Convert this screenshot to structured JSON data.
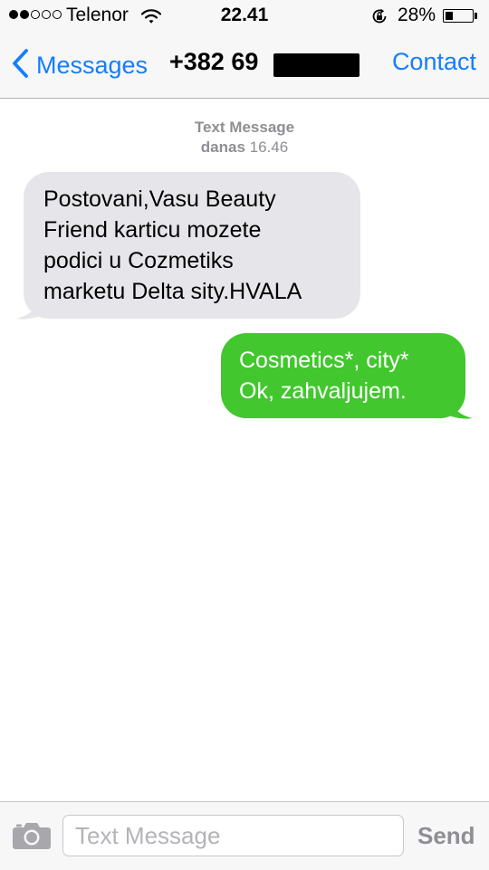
{
  "status_bar": {
    "signal_bars_filled": 2,
    "signal_bars_total": 5,
    "carrier": "Telenor",
    "wifi_icon": "wifi-icon",
    "time": "22.41",
    "orientation_lock_icon": "rotation-lock-icon",
    "battery_percent": "28%",
    "battery_level": 0.28
  },
  "nav": {
    "back_icon": "chevron-left-icon",
    "back_label": "Messages",
    "title": "+382 69",
    "contact_label": "Contact"
  },
  "conversation": {
    "service_label": "Text Message",
    "day_label": "danas",
    "time_label": "16.46",
    "messages": [
      {
        "direction": "incoming",
        "text": "Postovani,Vasu  Beauty\nFriend karticu mozete\npodici u Cozmetiks\nmarketu Delta sity.HVALA"
      },
      {
        "direction": "outgoing",
        "text": "Cosmetics*, city*\nOk, zahvaljujem."
      }
    ]
  },
  "input_bar": {
    "camera_icon": "camera-icon",
    "placeholder": "Text Message",
    "value": "",
    "send_label": "Send"
  },
  "colors": {
    "accent": "#147efb",
    "incoming_bubble": "#e5e5ea",
    "outgoing_bubble": "#42c72e",
    "meta_text": "#8e8e93"
  }
}
